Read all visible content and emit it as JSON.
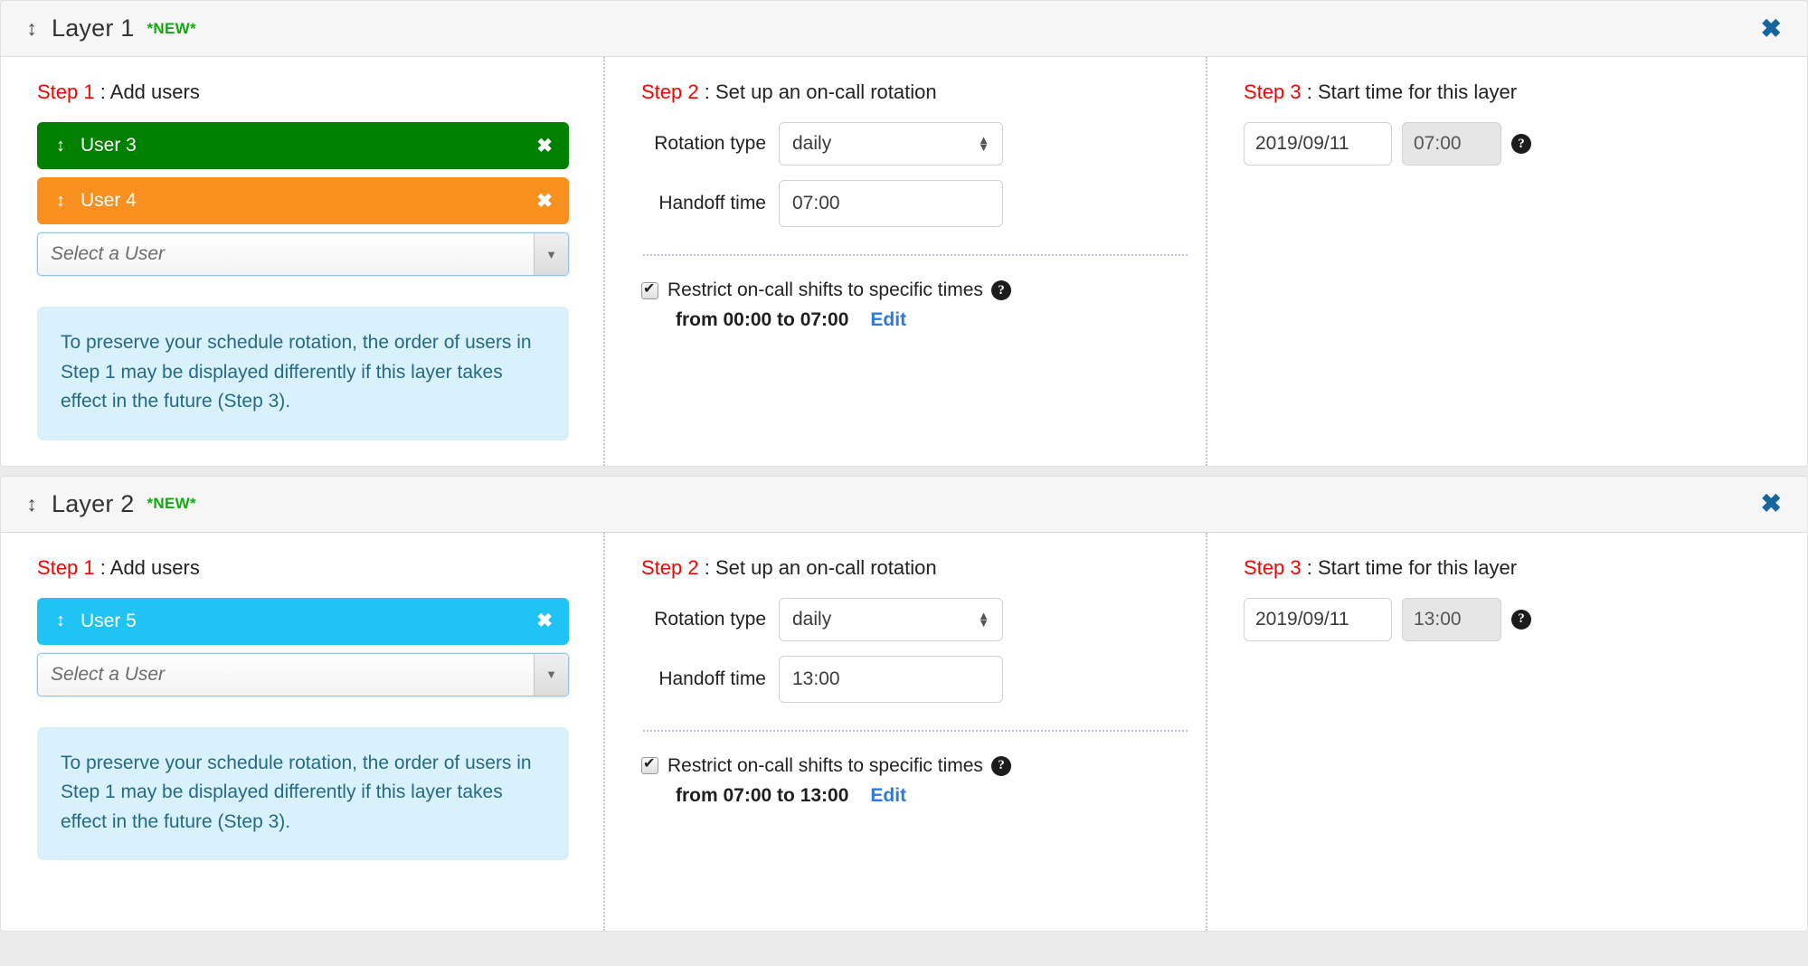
{
  "layers": [
    {
      "drag_handle_icon": "drag-vertical-icon",
      "title": "Layer 1",
      "badge": "*NEW*",
      "close_icon": "✖",
      "step1": {
        "label": "Step 1",
        "separator": ":",
        "title": "Add users",
        "users": [
          {
            "name": "User 3",
            "color": "#008000",
            "handle_icon": "drag-vertical-icon",
            "remove_icon": "✖"
          },
          {
            "name": "User 4",
            "color": "#f7901e",
            "handle_icon": "drag-vertical-icon",
            "remove_icon": "✖"
          }
        ],
        "select_placeholder": "Select a User",
        "select_arrow": "▼",
        "info_text": "To preserve your schedule rotation, the order of users in Step 1 may be displayed differently if this layer takes effect in the future (Step 3)."
      },
      "step2": {
        "label": "Step 2",
        "separator": ":",
        "title": "Set up an on-call rotation",
        "rotation_type_label": "Rotation type",
        "rotation_type_value": "daily",
        "handoff_label": "Handoff time",
        "handoff_value": "07:00",
        "restrict_label": "Restrict on-call shifts to specific times",
        "restrict_checked": true,
        "restrict_times": "from 00:00 to 07:00",
        "edit_label": "Edit",
        "help_icon": "?"
      },
      "step3": {
        "label": "Step 3",
        "separator": ":",
        "title": "Start time for this layer",
        "date_value": "2019/09/11",
        "time_value": "07:00",
        "help_icon": "?"
      }
    },
    {
      "drag_handle_icon": "drag-vertical-icon",
      "title": "Layer 2",
      "badge": "*NEW*",
      "close_icon": "✖",
      "step1": {
        "label": "Step 1",
        "separator": ":",
        "title": "Add users",
        "users": [
          {
            "name": "User 5",
            "color": "#20c4f4",
            "handle_icon": "drag-vertical-icon",
            "remove_icon": "✖"
          }
        ],
        "select_placeholder": "Select a User",
        "select_arrow": "▼",
        "info_text": "To preserve your schedule rotation, the order of users in Step 1 may be displayed differently if this layer takes effect in the future (Step 3)."
      },
      "step2": {
        "label": "Step 2",
        "separator": ":",
        "title": "Set up an on-call rotation",
        "rotation_type_label": "Rotation type",
        "rotation_type_value": "daily",
        "handoff_label": "Handoff time",
        "handoff_value": "13:00",
        "restrict_label": "Restrict on-call shifts to specific times",
        "restrict_checked": true,
        "restrict_times": "from 07:00 to 13:00",
        "edit_label": "Edit",
        "help_icon": "?"
      },
      "step3": {
        "label": "Step 3",
        "separator": ":",
        "title": "Start time for this layer",
        "date_value": "2019/09/11",
        "time_value": "13:00",
        "help_icon": "?"
      }
    }
  ],
  "icons": {
    "drag_handle": "↕",
    "spinner_up": "▲",
    "spinner_down": "▼"
  },
  "colors": {
    "step_label": "#ff0000",
    "new_badge": "#11a811",
    "close": "#15659f",
    "link": "#2a7ae2",
    "info_bg": "#d9f1fb",
    "info_text": "#246a85"
  }
}
